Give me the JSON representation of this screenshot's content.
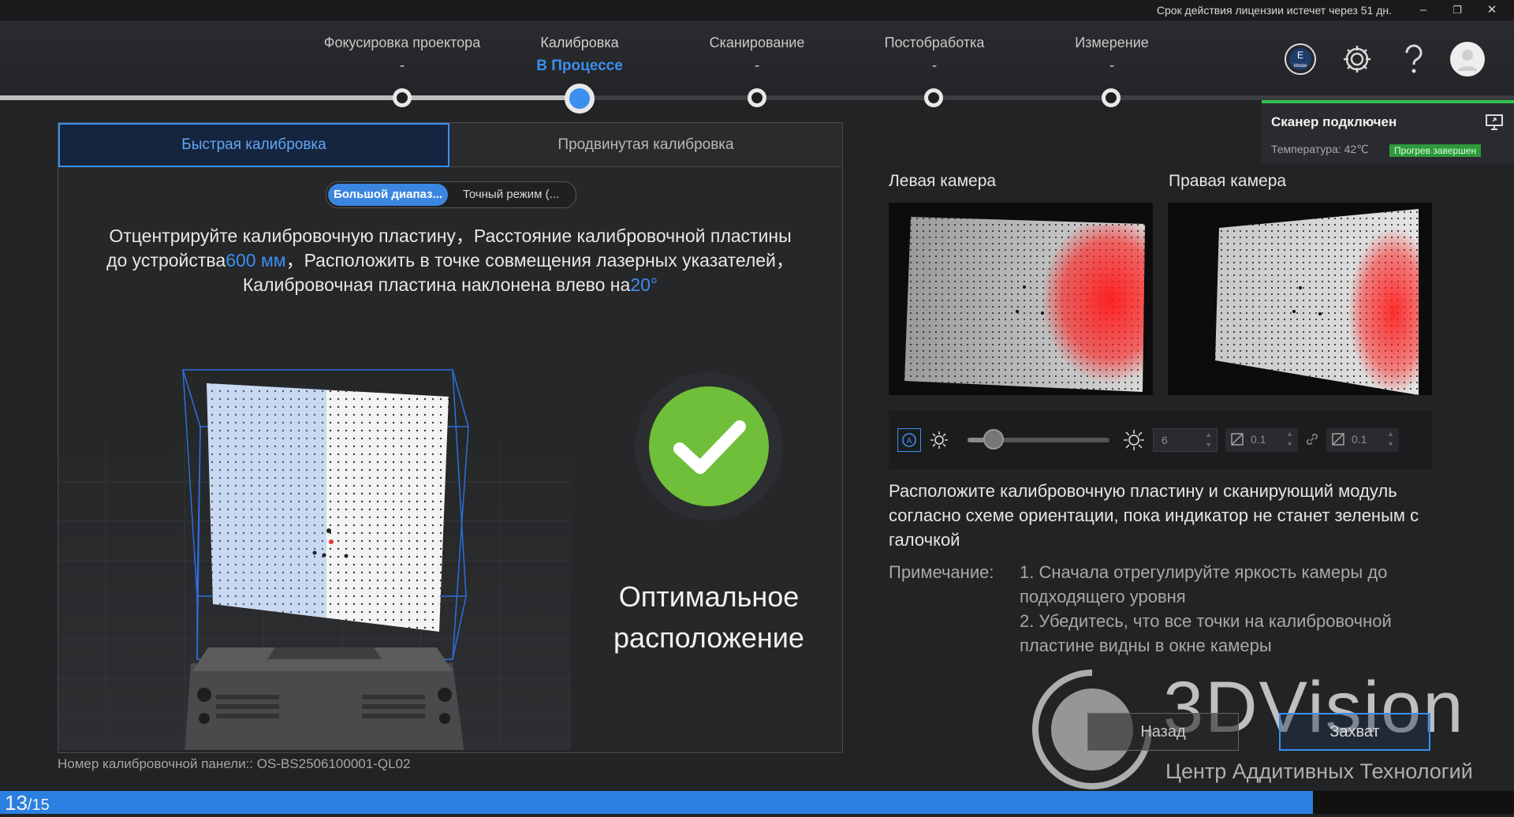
{
  "titlebar": {
    "license": "Срок действия лицензии истечет через 51 дн.",
    "minimize": "–",
    "restore": "❐",
    "close": "✕"
  },
  "steps": [
    {
      "label": "Фокусировка проектора",
      "status": "-"
    },
    {
      "label": "Калибровка",
      "status": "В Процессе"
    },
    {
      "label": "Сканирование",
      "status": "-"
    },
    {
      "label": "Постобработка",
      "status": "-"
    },
    {
      "label": "Измерение",
      "status": "-"
    }
  ],
  "header_icons": [
    "model-icon",
    "gear-icon",
    "help-icon",
    "avatar"
  ],
  "model_icon_text": "Model",
  "status": {
    "title": "Сканер подключен",
    "temperature": "Температура: 42℃",
    "badge": "Прогрев завершен",
    "accent": "#2fc150"
  },
  "tabs": {
    "quick": "Быстрая калибровка",
    "advanced": "Продвинутая калибровка"
  },
  "mode": {
    "large": "Большой диапаз...",
    "precise": "Точный режим (..."
  },
  "instruction": {
    "line1": "Отцентрируйте калибровочную пластину，Расстояние калибровочной пластины",
    "line2a": "до устройства",
    "distance": "600 мм",
    "line2b": "，Расположить в точке совмещения лазерных указателей，",
    "line3a": "Калибровочная пластина наклонена влево на",
    "angle": "20°"
  },
  "result": {
    "line1": "Оптимальное",
    "line2": "расположение"
  },
  "serial": "Номер калибровочной панели:: OS-BS2506100001-QL02",
  "cameras": {
    "left": "Левая камера",
    "right": "Правая камера"
  },
  "camera_controls": {
    "brightness_value": "6",
    "gain1": "0.1",
    "gain2": "0.1"
  },
  "description": "Расположите калибровочную пластину и сканирующий модуль согласно схеме ориентации, пока индикатор не станет зеленым с галочкой",
  "note": {
    "label": "Примечание:",
    "item1": "1. Сначала отрегулируйте яркость камеры до подходящего уровня",
    "item2": "2. Убедитесь, что все точки на калибровочной пластине видны в окне камеры"
  },
  "buttons": {
    "back": "Назад",
    "capture": "Захват"
  },
  "watermark": {
    "brand": "3DVision",
    "subtitle": "Центр Аддитивных Технологий"
  },
  "progress": {
    "current": "13",
    "total": "/15",
    "fraction": 0.867
  },
  "colors": {
    "accent": "#3c8ef0",
    "ok_green": "#6fbf3a"
  }
}
